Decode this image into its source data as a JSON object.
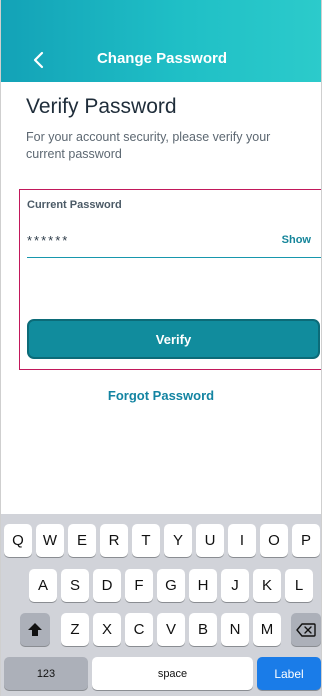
{
  "header": {
    "title": "Change Password",
    "back_icon": "chevron-left-icon"
  },
  "page": {
    "title": "Verify Password",
    "subtitle": "For your account security, please verify your current password"
  },
  "form": {
    "field_label": "Current Password",
    "password_value": "******",
    "show_label": "Show",
    "verify_label": "Verify"
  },
  "links": {
    "forgot_password": "Forgot Password"
  },
  "keyboard": {
    "row1": [
      "Q",
      "W",
      "E",
      "R",
      "T",
      "Y",
      "U",
      "I",
      "O",
      "P"
    ],
    "row2": [
      "A",
      "S",
      "D",
      "F",
      "G",
      "H",
      "J",
      "K",
      "L"
    ],
    "row3": [
      "Z",
      "X",
      "C",
      "V",
      "B",
      "N",
      "M"
    ],
    "numbers_label": "123",
    "space_label": "space",
    "action_label": "Label",
    "shift_icon": "shift-icon",
    "delete_icon": "backspace-icon"
  },
  "colors": {
    "header_gradient_start": "#13a2b7",
    "header_gradient_end": "#2ccbcb",
    "primary_button": "#118c9d",
    "link": "#1384a2",
    "highlight_border": "#c2185b",
    "keyboard_bg": "#d1d3d9",
    "action_key": "#1a7ce8"
  }
}
